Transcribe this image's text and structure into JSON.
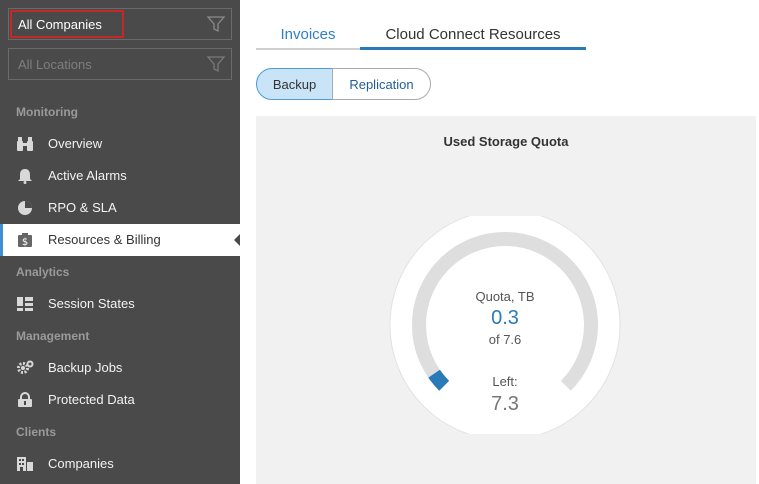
{
  "sidebar": {
    "company_filter": {
      "value": "All Companies",
      "icon": "filter-icon"
    },
    "location_filter": {
      "placeholder": "All Locations",
      "icon": "filter-icon"
    },
    "sections": {
      "monitoring": "Monitoring",
      "analytics": "Analytics",
      "management": "Management",
      "clients": "Clients"
    },
    "items": [
      {
        "label": "Overview",
        "icon": "binoculars-icon"
      },
      {
        "label": "Active Alarms",
        "icon": "bell-icon"
      },
      {
        "label": "RPO & SLA",
        "icon": "pie-chart-icon"
      },
      {
        "label": "Resources & Billing",
        "icon": "billing-icon",
        "active": true
      },
      {
        "label": "Session States",
        "icon": "session-grid-icon"
      },
      {
        "label": "Backup Jobs",
        "icon": "gear-icon"
      },
      {
        "label": "Protected Data",
        "icon": "lock-icon"
      },
      {
        "label": "Companies",
        "icon": "building-icon"
      }
    ]
  },
  "main": {
    "tabs": [
      {
        "label": "Invoices"
      },
      {
        "label": "Cloud Connect Resources",
        "active": true
      }
    ],
    "segments": [
      {
        "label": "Backup",
        "active": true
      },
      {
        "label": "Replication"
      }
    ],
    "panel": {
      "title": "Used Storage Quota",
      "gauge": {
        "caption": "Quota, TB",
        "used": "0.3",
        "total_text": "of 7.6",
        "left_label": "Left:",
        "left_value": "7.3",
        "used_fraction": 0.039,
        "colors": {
          "used": "#2a7ab8",
          "track": "#dedede"
        }
      }
    }
  }
}
